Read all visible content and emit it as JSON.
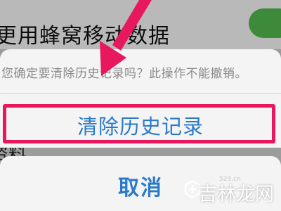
{
  "background": {
    "row_label": "更用蜂窝移动数据",
    "lower_text": "资料"
  },
  "action_sheet": {
    "message": "您确定要清除历史记录吗？此操作不能撤销。",
    "clear_label": "清除历史记录",
    "cancel_label": "取消"
  },
  "watermark": {
    "text": "吉林龙网",
    "url": "529.cn"
  },
  "colors": {
    "accent_blue": "#2a7ac9",
    "highlight": "#e8185e",
    "toggle_on": "#3d8b3a"
  }
}
